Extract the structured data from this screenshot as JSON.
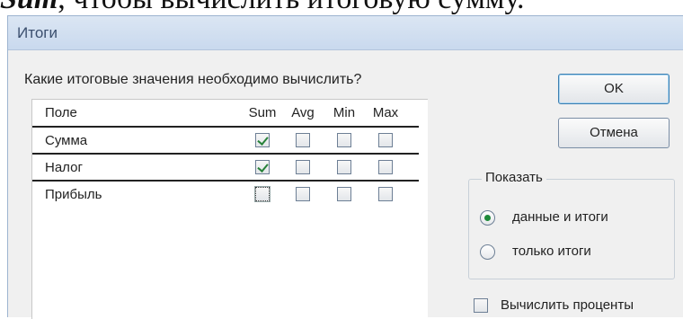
{
  "document_fragment": {
    "italic_word": "Sum",
    "text": ", чтобы вычислить итоговую сумму."
  },
  "dialog": {
    "title": "Итоги",
    "question": "Какие итоговые значения необходимо вычислить?",
    "columns": {
      "field": "Поле",
      "sum": "Sum",
      "avg": "Avg",
      "min": "Min",
      "max": "Max"
    },
    "rows": [
      {
        "name": "Сумма",
        "sum": true,
        "avg": false,
        "min": false,
        "max": false
      },
      {
        "name": "Налог",
        "sum": true,
        "avg": false,
        "min": false,
        "max": false
      },
      {
        "name": "Прибыль",
        "sum": false,
        "avg": false,
        "min": false,
        "max": false
      }
    ],
    "ok_label": "OK",
    "cancel_label": "Отмена",
    "show_group": {
      "legend": "Показать",
      "option_data_and_totals": "данные и итоги",
      "option_totals_only": "только итоги",
      "selected": "данные и итоги"
    },
    "percent_label": "Вычислить проценты",
    "percent_checked": false
  },
  "colors": {
    "titlebar": "#c9d9ee",
    "check": "#27823a",
    "radio_dot": "#1f8a3a"
  }
}
